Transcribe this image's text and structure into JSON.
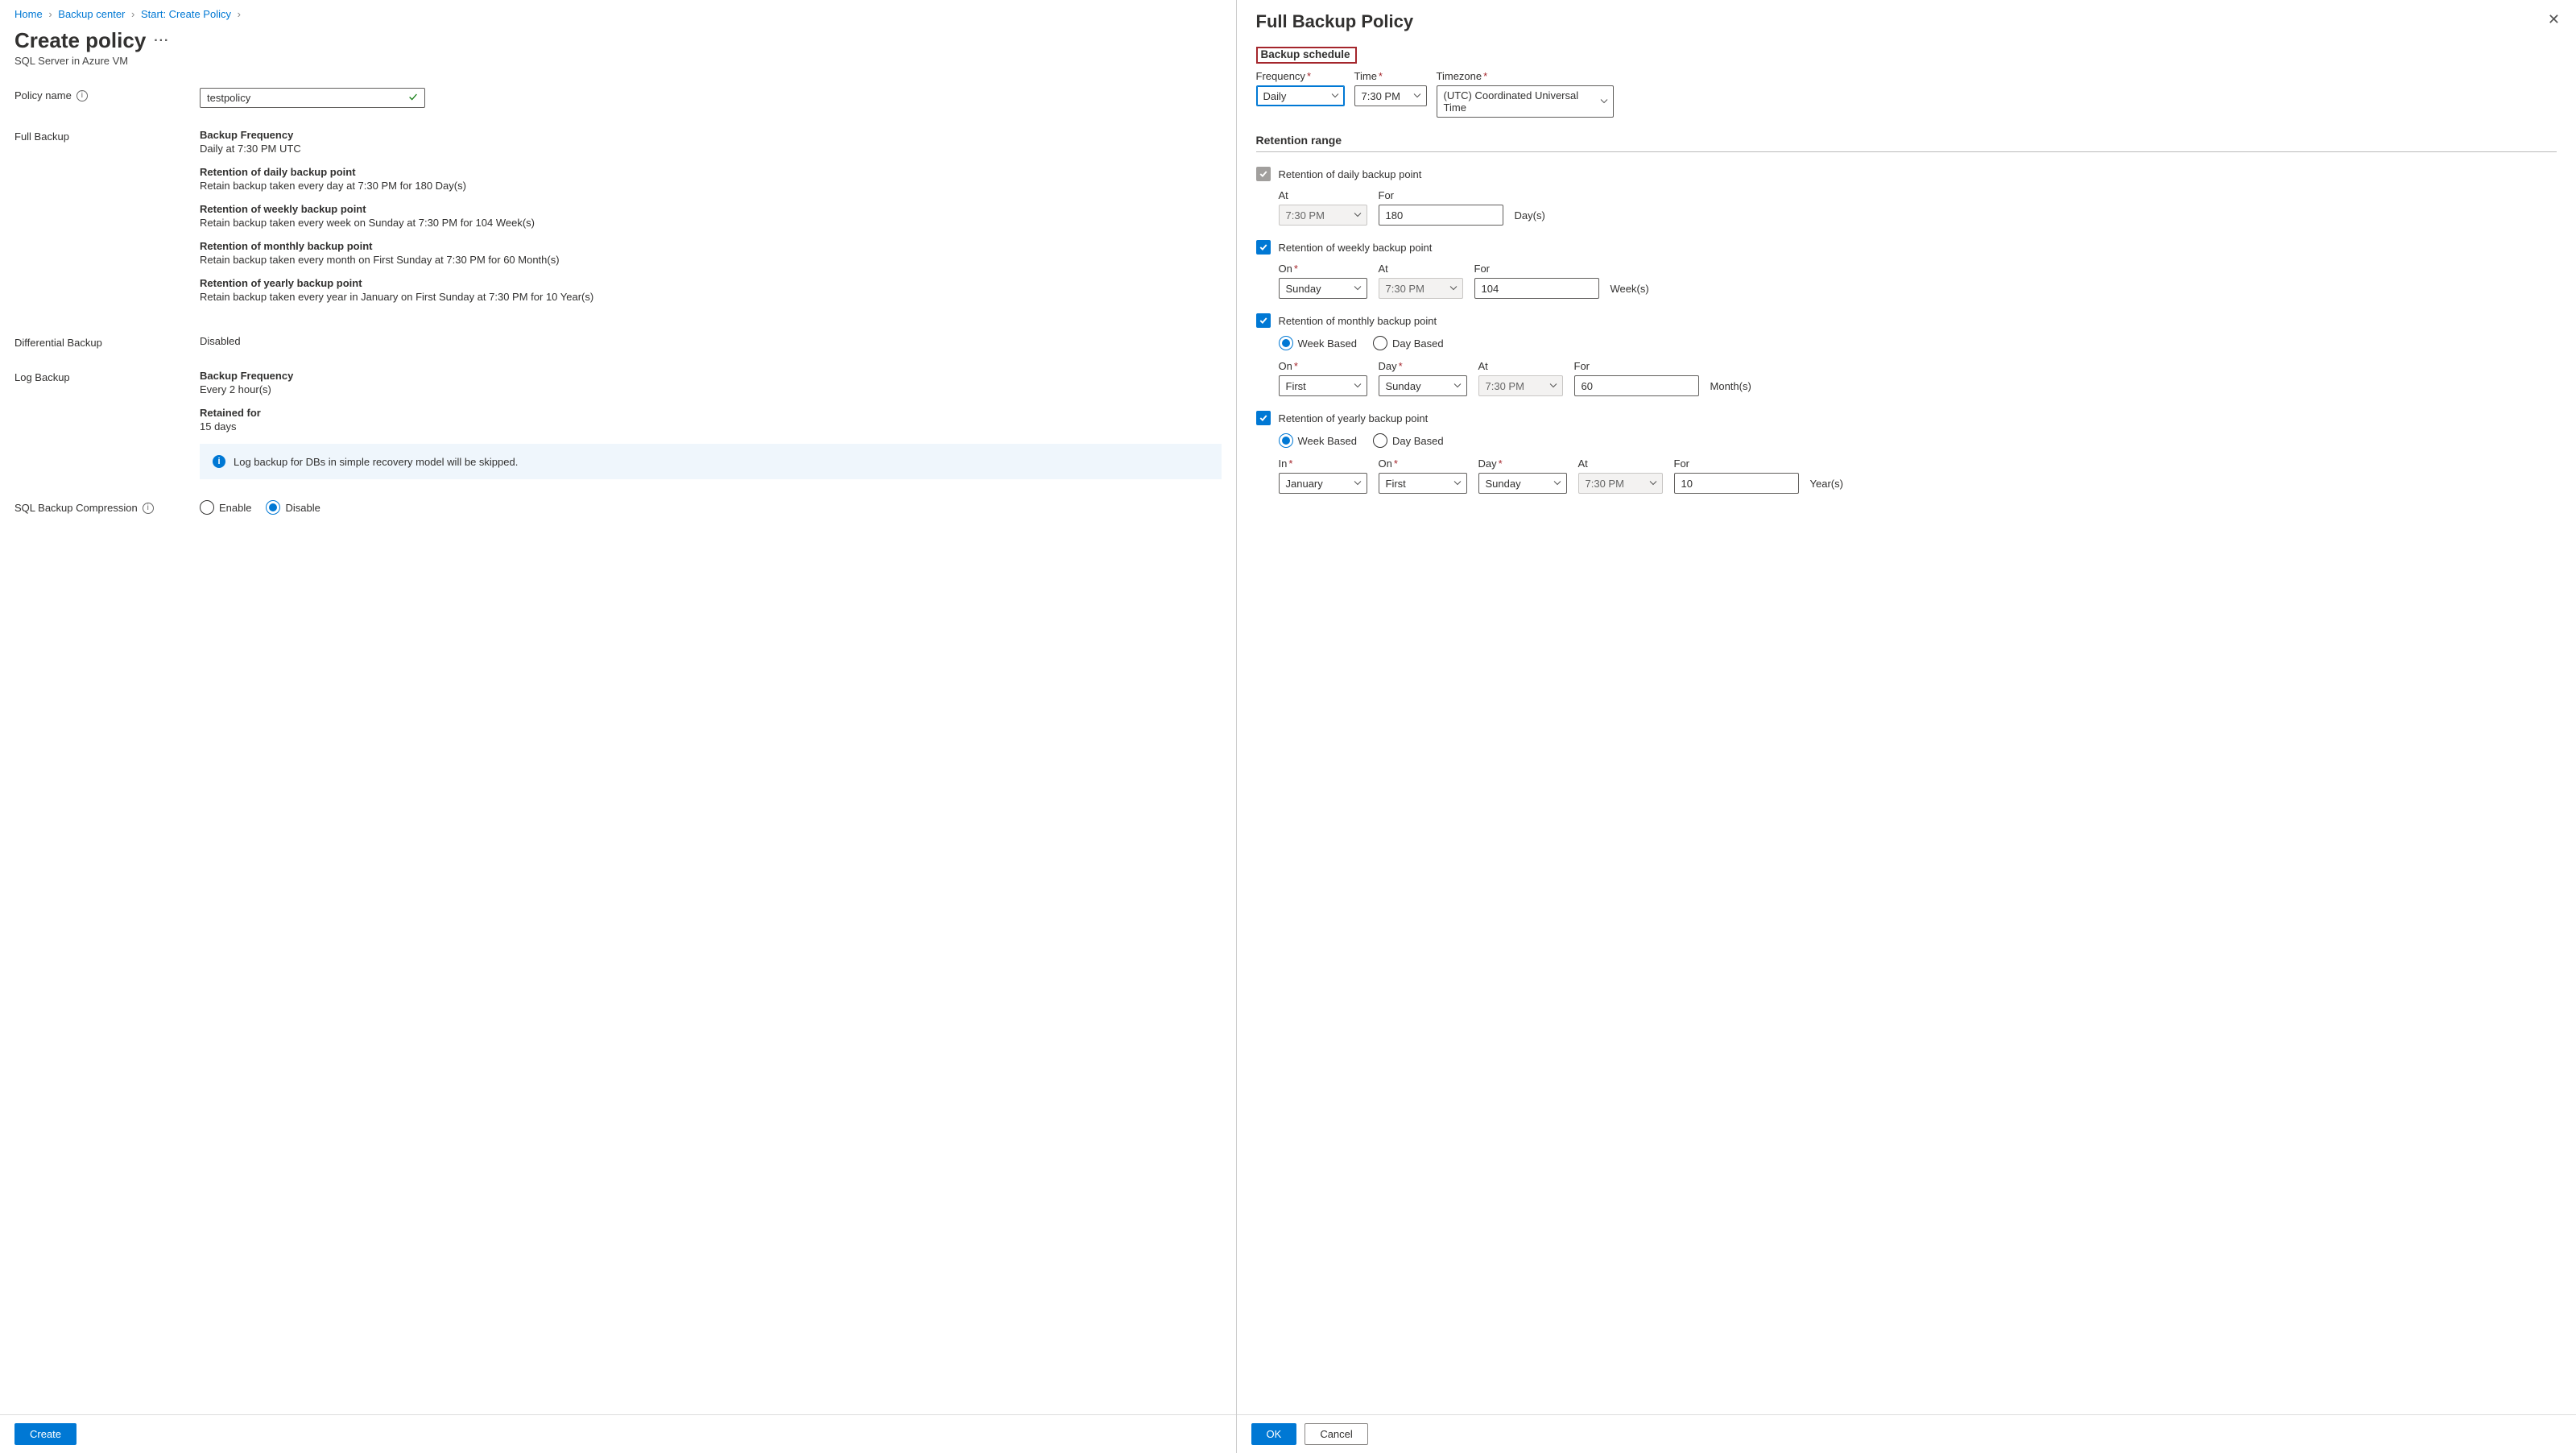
{
  "breadcrumb": [
    "Home",
    "Backup center",
    "Start: Create Policy"
  ],
  "page": {
    "title": "Create policy",
    "subtitle": "SQL Server in Azure VM"
  },
  "policyName": {
    "label": "Policy name",
    "value": "testpolicy"
  },
  "fullBackup": {
    "label": "Full Backup",
    "freqHeading": "Backup Frequency",
    "freqText": "Daily at 7:30 PM UTC",
    "dailyHeading": "Retention of daily backup point",
    "dailyText": "Retain backup taken every day at 7:30 PM for 180 Day(s)",
    "weeklyHeading": "Retention of weekly backup point",
    "weeklyText": "Retain backup taken every week on Sunday at 7:30 PM for 104 Week(s)",
    "monthlyHeading": "Retention of monthly backup point",
    "monthlyText": "Retain backup taken every month on First Sunday at 7:30 PM for 60 Month(s)",
    "yearlyHeading": "Retention of yearly backup point",
    "yearlyText": "Retain backup taken every year in January on First Sunday at 7:30 PM for 10 Year(s)"
  },
  "diffBackup": {
    "label": "Differential Backup",
    "value": "Disabled"
  },
  "logBackup": {
    "label": "Log Backup",
    "freqHeading": "Backup Frequency",
    "freqText": "Every 2 hour(s)",
    "retainedHeading": "Retained for",
    "retainedText": "15 days",
    "info": "Log backup for DBs in simple recovery model will be skipped."
  },
  "compression": {
    "label": "SQL Backup Compression",
    "enable": "Enable",
    "disable": "Disable"
  },
  "footer": {
    "create": "Create",
    "ok": "OK",
    "cancel": "Cancel"
  },
  "panel": {
    "title": "Full Backup Policy",
    "scheduleHeading": "Backup schedule",
    "frequency": {
      "label": "Frequency",
      "value": "Daily"
    },
    "time": {
      "label": "Time",
      "value": "7:30 PM"
    },
    "timezone": {
      "label": "Timezone",
      "value": "(UTC) Coordinated Universal Time"
    },
    "retentionHeading": "Retention range",
    "daily": {
      "label": "Retention of daily backup point",
      "at": "At",
      "atValue": "7:30 PM",
      "for": "For",
      "forValue": "180",
      "unit": "Day(s)"
    },
    "weekly": {
      "label": "Retention of weekly backup point",
      "on": "On",
      "onValue": "Sunday",
      "at": "At",
      "atValue": "7:30 PM",
      "for": "For",
      "forValue": "104",
      "unit": "Week(s)"
    },
    "monthly": {
      "label": "Retention of monthly backup point",
      "weekBased": "Week Based",
      "dayBased": "Day Based",
      "on": "On",
      "onValue": "First",
      "day": "Day",
      "dayValue": "Sunday",
      "at": "At",
      "atValue": "7:30 PM",
      "for": "For",
      "forValue": "60",
      "unit": "Month(s)"
    },
    "yearly": {
      "label": "Retention of yearly backup point",
      "weekBased": "Week Based",
      "dayBased": "Day Based",
      "in": "In",
      "inValue": "January",
      "on": "On",
      "onValue": "First",
      "day": "Day",
      "dayValue": "Sunday",
      "at": "At",
      "atValue": "7:30 PM",
      "for": "For",
      "forValue": "10",
      "unit": "Year(s)"
    }
  }
}
